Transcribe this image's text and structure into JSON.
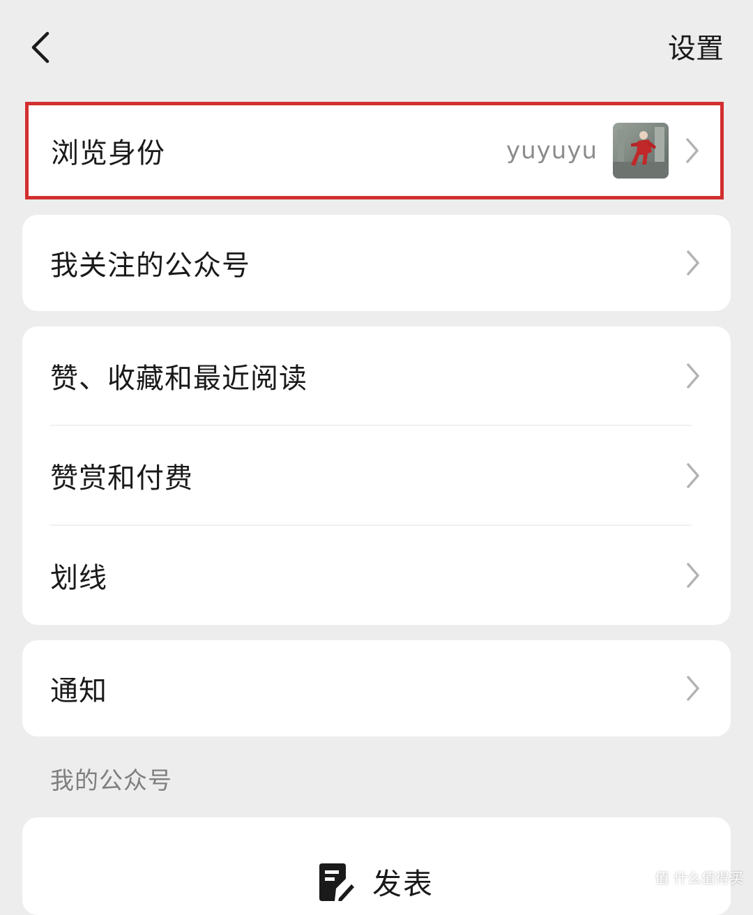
{
  "topbar": {
    "back_icon": "chevron-left-icon",
    "settings_label": "设置"
  },
  "identity": {
    "label": "浏览身份",
    "value": "yuyuyu",
    "highlight_color": "#d32f2f"
  },
  "followed": {
    "label": "我关注的公众号"
  },
  "group": {
    "items": [
      {
        "label": "赞、收藏和最近阅读"
      },
      {
        "label": "赞赏和付费"
      },
      {
        "label": "划线"
      }
    ]
  },
  "notify": {
    "label": "通知"
  },
  "my_accounts": {
    "section_title": "我的公众号",
    "publish_label": "发表",
    "publish_icon": "edit-icon"
  },
  "watermark": {
    "text": "值 什么值得买"
  }
}
